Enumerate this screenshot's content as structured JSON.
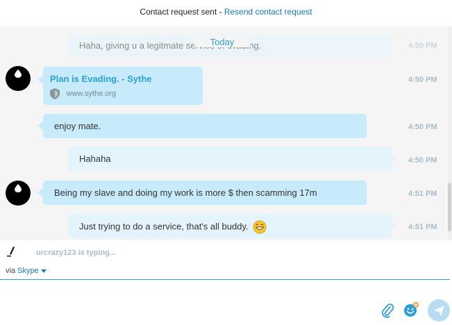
{
  "banner": {
    "status": "Contact request sent - ",
    "action": "Resend contact request"
  },
  "date_separator": "Today",
  "messages": [
    {
      "text": "Haha, giving u a legitmate service of evading.",
      "time": "4:50 PM"
    },
    {
      "link_title": "Plan is Evading. - Sythe",
      "link_url": "www.sythe.org",
      "time": "4:50 PM"
    },
    {
      "text": "enjoy mate.",
      "time": "4:50 PM"
    },
    {
      "text": "Hahaha",
      "time": "4:50 PM"
    },
    {
      "text": "Being my slave and doing my work is more $ then scamming 17m",
      "time": "4:51 PM"
    },
    {
      "text": "Just trying to do a service, that's all buddy.",
      "time": "4:51 PM"
    }
  ],
  "typing": {
    "text": "urcrazy123 is typing..."
  },
  "via": {
    "label": "via",
    "service": "Skype"
  },
  "compose": {
    "placeholder": ""
  },
  "colors": {
    "accent": "#2aa0d6",
    "incoming": "#c7ebfb",
    "outgoing": "#e3f4fc"
  },
  "icons": [
    "shield-icon",
    "smile-emoji-icon",
    "pencil-icon",
    "paperclip-icon",
    "emoticon-picker-icon",
    "send-icon"
  ]
}
